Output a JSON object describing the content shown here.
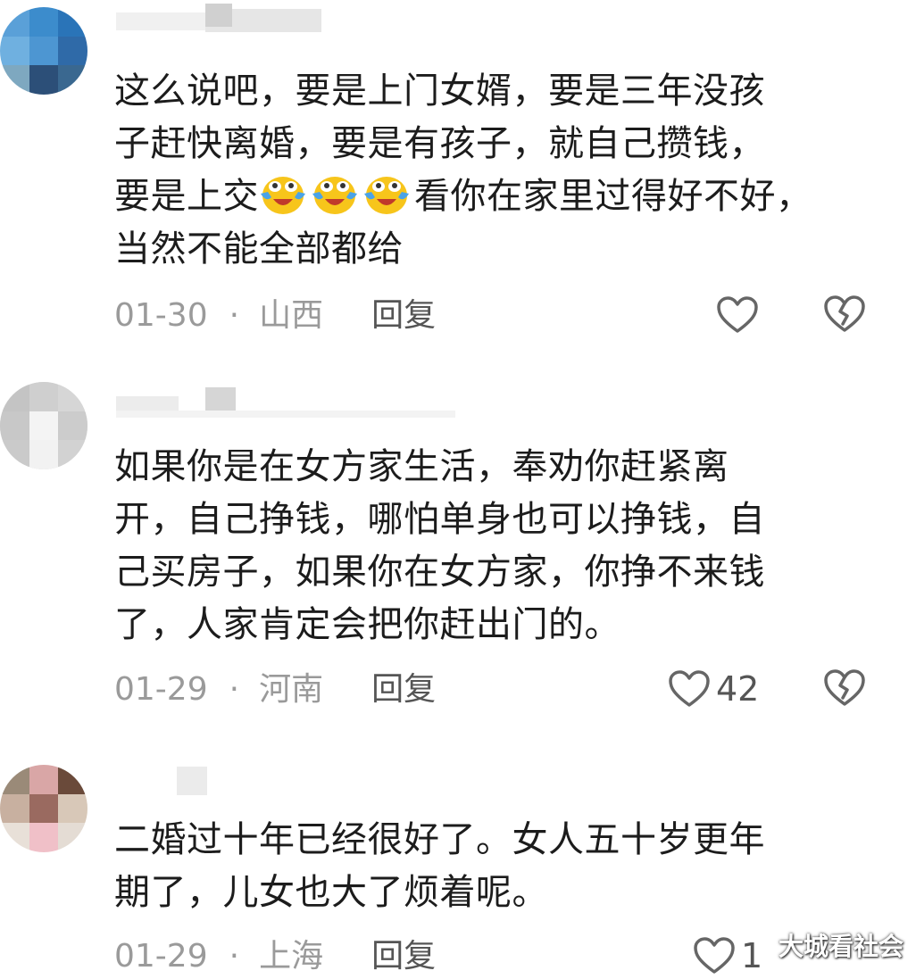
{
  "comments": [
    {
      "body_lines": [
        "这么说吧，要是上门女婿，要是三年没孩",
        "子赶快离婚，要是有孩子，就自己攒钱，"
      ],
      "line3_before": "要是上交",
      "line3_after": "看你在家里过得好不好，",
      "line4": "当然不能全部都给",
      "emoji": "grinning-tears-emoji",
      "date": "01-30",
      "location": "山西",
      "reply": "回复",
      "likes": ""
    },
    {
      "body_lines": [
        "如果你是在女方家生活，奉劝你赶紧离",
        "开，自己挣钱，哪怕单身也可以挣钱，自",
        "己买房子，如果你在女方家，你挣不来钱",
        "了，人家肯定会把你赶出门的。"
      ],
      "date": "01-29",
      "location": "河南",
      "reply": "回复",
      "likes": "42"
    },
    {
      "body_lines": [
        "二婚过十年已经很好了。女人五十岁更年",
        "期了，儿女也大了烦着呢。"
      ],
      "date": "01-29",
      "location": "上海",
      "reply": "回复",
      "likes": "1"
    }
  ],
  "icons": {
    "like": "heart-outline-icon",
    "dislike": "broken-heart-icon"
  },
  "colors": {
    "text": "#1c1c1c",
    "meta": "#9a9a9a",
    "icon": "#666666"
  },
  "watermark": "大城看社会"
}
